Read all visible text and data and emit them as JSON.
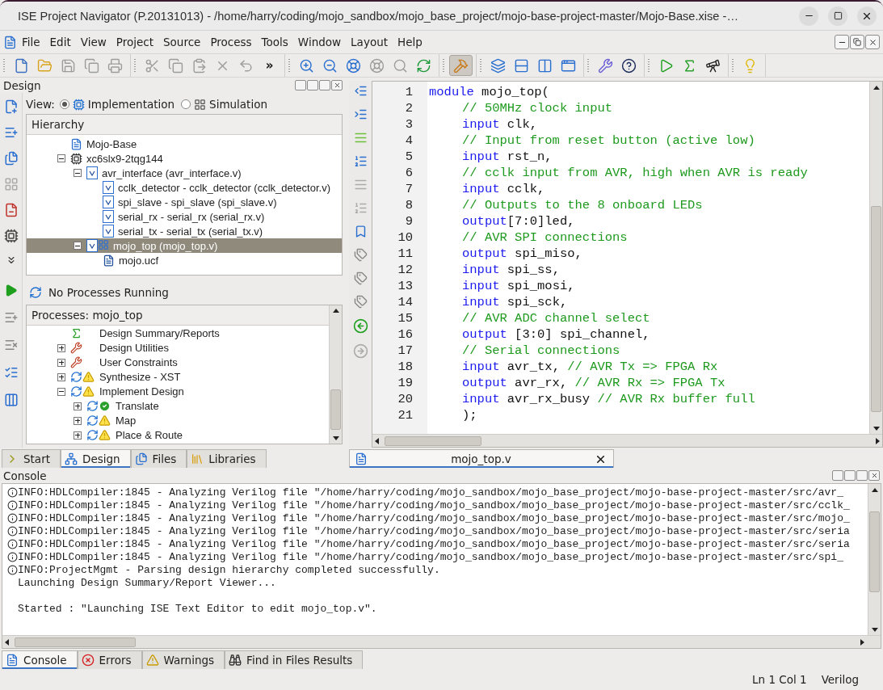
{
  "window": {
    "title": "ISE Project Navigator (P.20131013) - /home/harry/coding/mojo_sandbox/mojo_base_project/mojo-base-project-master/Mojo-Base.xise -…"
  },
  "menu": [
    "File",
    "Edit",
    "View",
    "Project",
    "Source",
    "Process",
    "Tools",
    "Window",
    "Layout",
    "Help"
  ],
  "toolbar_groups": [
    {
      "items": [
        {
          "kind": "new",
          "disabled": false,
          "selected": false
        },
        {
          "kind": "open",
          "disabled": false,
          "selected": false
        },
        {
          "kind": "save",
          "disabled": true,
          "selected": false
        },
        {
          "kind": "save-all",
          "disabled": true,
          "selected": false
        },
        {
          "kind": "print",
          "disabled": true,
          "selected": false
        }
      ]
    },
    {
      "items": [
        {
          "kind": "cut",
          "disabled": true,
          "selected": false
        },
        {
          "kind": "copy",
          "disabled": true,
          "selected": false
        },
        {
          "kind": "paste",
          "disabled": true,
          "selected": false
        },
        {
          "kind": "delete",
          "disabled": true,
          "selected": false
        },
        {
          "kind": "undo",
          "disabled": true,
          "selected": false
        },
        {
          "kind": "more",
          "text": "»",
          "disabled": false,
          "selected": false
        }
      ]
    },
    {
      "items": [
        {
          "kind": "zoom-in",
          "disabled": false,
          "selected": false
        },
        {
          "kind": "zoom-out",
          "disabled": false,
          "selected": false
        },
        {
          "kind": "zoom-full",
          "disabled": false,
          "selected": false
        },
        {
          "kind": "zoom-select",
          "disabled": true,
          "selected": false
        },
        {
          "kind": "find",
          "disabled": true,
          "selected": false
        },
        {
          "kind": "refresh",
          "disabled": false,
          "selected": false
        }
      ]
    },
    {
      "items": [
        {
          "kind": "hammer",
          "disabled": false,
          "selected": true
        }
      ]
    },
    {
      "items": [
        {
          "kind": "cascade",
          "disabled": false,
          "selected": false
        },
        {
          "kind": "tile-h",
          "disabled": false,
          "selected": false
        },
        {
          "kind": "tile-v",
          "disabled": false,
          "selected": false
        },
        {
          "kind": "windows",
          "disabled": false,
          "selected": false
        }
      ]
    },
    {
      "items": [
        {
          "kind": "wrench",
          "disabled": false,
          "selected": false
        },
        {
          "kind": "help",
          "disabled": false,
          "selected": false
        }
      ]
    },
    {
      "items": [
        {
          "kind": "run",
          "disabled": false,
          "selected": false
        },
        {
          "kind": "sigma",
          "disabled": false,
          "selected": false
        },
        {
          "kind": "telescope",
          "disabled": false,
          "selected": false
        }
      ]
    },
    {
      "items": [
        {
          "kind": "bulb",
          "disabled": false,
          "selected": false
        }
      ]
    }
  ],
  "design_panel": {
    "title": "Design",
    "view_label": "View:",
    "views": [
      {
        "label": "Implementation",
        "selected": true
      },
      {
        "label": "Simulation",
        "selected": false
      }
    ],
    "hierarchy_title": "Hierarchy",
    "tree": [
      {
        "label": "Mojo-Base",
        "kind": "project",
        "selected": false
      },
      {
        "label": "xc6slx9-2tqg144",
        "kind": "chip",
        "selected": false,
        "expanded": true,
        "children": [
          {
            "label": "avr_interface (avr_interface.v)",
            "kind": "verilog",
            "selected": false,
            "expanded": true,
            "children": [
              {
                "label": "cclk_detector - cclk_detector (cclk_detector.v)",
                "kind": "verilog",
                "selected": false
              },
              {
                "label": "spi_slave - spi_slave (spi_slave.v)",
                "kind": "verilog",
                "selected": false
              },
              {
                "label": "serial_rx - serial_rx (serial_rx.v)",
                "kind": "verilog",
                "selected": false
              },
              {
                "label": "serial_tx - serial_tx (serial_tx.v)",
                "kind": "verilog",
                "selected": false
              }
            ]
          },
          {
            "label": "mojo_top (mojo_top.v)",
            "kind": "verilog-top",
            "selected": true,
            "expanded": true,
            "children": [
              {
                "label": "mojo.ucf",
                "kind": "ucf",
                "selected": false
              }
            ]
          }
        ]
      }
    ]
  },
  "processes": {
    "status": "No Processes Running",
    "title": "Processes: mojo_top",
    "items": [
      {
        "label": "Design Summary/Reports",
        "kind": "summary",
        "warning": false,
        "passed": false
      },
      {
        "label": "Design Utilities",
        "kind": "tools",
        "warning": false,
        "passed": false,
        "expanded": false
      },
      {
        "label": "User Constraints",
        "kind": "tools",
        "warning": false,
        "passed": false,
        "expanded": false
      },
      {
        "label": "Synthesize - XST",
        "kind": "process",
        "warning": true,
        "passed": false,
        "expanded": false
      },
      {
        "label": "Implement Design",
        "kind": "process",
        "warning": true,
        "passed": false,
        "expanded": true,
        "children": [
          {
            "label": "Translate",
            "kind": "process",
            "warning": false,
            "passed": true,
            "expanded": false
          },
          {
            "label": "Map",
            "kind": "process",
            "warning": true,
            "passed": false,
            "expanded": false
          },
          {
            "label": "Place & Route",
            "kind": "process",
            "warning": true,
            "passed": false,
            "expanded": false
          }
        ]
      }
    ]
  },
  "left_tabs": [
    {
      "label": "Start",
      "kind": "start",
      "selected": false
    },
    {
      "label": "Design",
      "kind": "design",
      "selected": true
    },
    {
      "label": "Files",
      "kind": "files",
      "selected": false
    },
    {
      "label": "Libraries",
      "kind": "libraries",
      "selected": false
    }
  ],
  "editor": {
    "tab": {
      "label": "mojo_top.v",
      "selected": true
    },
    "lines": [
      {
        "number": "1",
        "indented": false,
        "tokens": [
          {
            "kind": "keyword",
            "text": "module"
          },
          {
            "kind": "text",
            "text": " mojo_top("
          }
        ]
      },
      {
        "number": "2",
        "indented": true,
        "tokens": [
          {
            "kind": "comment",
            "text": "// 50MHz clock input"
          }
        ]
      },
      {
        "number": "3",
        "indented": true,
        "tokens": [
          {
            "kind": "keyword",
            "text": "input"
          },
          {
            "kind": "text",
            "text": " clk,"
          }
        ]
      },
      {
        "number": "4",
        "indented": true,
        "tokens": [
          {
            "kind": "comment",
            "text": "// Input from reset button (active low)"
          }
        ]
      },
      {
        "number": "5",
        "indented": true,
        "tokens": [
          {
            "kind": "keyword",
            "text": "input"
          },
          {
            "kind": "text",
            "text": " rst_n,"
          }
        ]
      },
      {
        "number": "6",
        "indented": true,
        "tokens": [
          {
            "kind": "comment",
            "text": "// cclk input from AVR, high when AVR is ready"
          }
        ]
      },
      {
        "number": "7",
        "indented": true,
        "tokens": [
          {
            "kind": "keyword",
            "text": "input"
          },
          {
            "kind": "text",
            "text": " cclk,"
          }
        ]
      },
      {
        "number": "8",
        "indented": true,
        "tokens": [
          {
            "kind": "comment",
            "text": "// Outputs to the 8 onboard LEDs"
          }
        ]
      },
      {
        "number": "9",
        "indented": true,
        "tokens": [
          {
            "kind": "keyword",
            "text": "output"
          },
          {
            "kind": "text",
            "text": "[7:0]led,"
          }
        ]
      },
      {
        "number": "10",
        "indented": true,
        "tokens": [
          {
            "kind": "comment",
            "text": "// AVR SPI connections"
          }
        ]
      },
      {
        "number": "11",
        "indented": true,
        "tokens": [
          {
            "kind": "keyword",
            "text": "output"
          },
          {
            "kind": "text",
            "text": " spi_miso,"
          }
        ]
      },
      {
        "number": "12",
        "indented": true,
        "tokens": [
          {
            "kind": "keyword",
            "text": "input"
          },
          {
            "kind": "text",
            "text": " spi_ss,"
          }
        ]
      },
      {
        "number": "13",
        "indented": true,
        "tokens": [
          {
            "kind": "keyword",
            "text": "input"
          },
          {
            "kind": "text",
            "text": " spi_mosi,"
          }
        ]
      },
      {
        "number": "14",
        "indented": true,
        "tokens": [
          {
            "kind": "keyword",
            "text": "input"
          },
          {
            "kind": "text",
            "text": " spi_sck,"
          }
        ]
      },
      {
        "number": "15",
        "indented": true,
        "tokens": [
          {
            "kind": "comment",
            "text": "// AVR ADC channel select"
          }
        ]
      },
      {
        "number": "16",
        "indented": true,
        "tokens": [
          {
            "kind": "keyword",
            "text": "output"
          },
          {
            "kind": "text",
            "text": " [3:0] spi_channel,"
          }
        ]
      },
      {
        "number": "17",
        "indented": true,
        "tokens": [
          {
            "kind": "comment",
            "text": "// Serial connections"
          }
        ]
      },
      {
        "number": "18",
        "indented": true,
        "tokens": [
          {
            "kind": "keyword",
            "text": "input"
          },
          {
            "kind": "text",
            "text": " avr_tx, "
          },
          {
            "kind": "comment",
            "text": "// AVR Tx => FPGA Rx"
          }
        ]
      },
      {
        "number": "19",
        "indented": true,
        "tokens": [
          {
            "kind": "keyword",
            "text": "output"
          },
          {
            "kind": "text",
            "text": " avr_rx, "
          },
          {
            "kind": "comment",
            "text": "// AVR Rx => FPGA Tx"
          }
        ]
      },
      {
        "number": "20",
        "indented": true,
        "tokens": [
          {
            "kind": "keyword",
            "text": "input"
          },
          {
            "kind": "text",
            "text": " avr_rx_busy "
          },
          {
            "kind": "comment",
            "text": "// AVR Rx buffer full"
          }
        ]
      },
      {
        "number": "21",
        "indented": true,
        "tokens": [
          {
            "kind": "text",
            "text": ");"
          }
        ]
      }
    ]
  },
  "console": {
    "title": "Console",
    "lines": [
      {
        "text": "INFO:HDLCompiler:1845 - Analyzing Verilog file \"/home/harry/coding/mojo_sandbox/mojo_base_project/mojo-base-project-master/src/avr_",
        "info": true,
        "blank_before": false
      },
      {
        "text": "INFO:HDLCompiler:1845 - Analyzing Verilog file \"/home/harry/coding/mojo_sandbox/mojo_base_project/mojo-base-project-master/src/cclk_",
        "info": true,
        "blank_before": false
      },
      {
        "text": "INFO:HDLCompiler:1845 - Analyzing Verilog file \"/home/harry/coding/mojo_sandbox/mojo_base_project/mojo-base-project-master/src/mojo_",
        "info": true,
        "blank_before": false
      },
      {
        "text": "INFO:HDLCompiler:1845 - Analyzing Verilog file \"/home/harry/coding/mojo_sandbox/mojo_base_project/mojo-base-project-master/src/seria",
        "info": true,
        "blank_before": false
      },
      {
        "text": "INFO:HDLCompiler:1845 - Analyzing Verilog file \"/home/harry/coding/mojo_sandbox/mojo_base_project/mojo-base-project-master/src/seria",
        "info": true,
        "blank_before": false
      },
      {
        "text": "INFO:HDLCompiler:1845 - Analyzing Verilog file \"/home/harry/coding/mojo_sandbox/mojo_base_project/mojo-base-project-master/src/spi_",
        "info": true,
        "blank_before": false
      },
      {
        "text": "INFO:ProjectMgmt - Parsing design hierarchy completed successfully.",
        "info": true,
        "blank_before": false
      },
      {
        "text": "Launching Design Summary/Report Viewer...",
        "info": false,
        "blank_before": false
      },
      {
        "text": "Started : \"Launching ISE Text Editor to edit mojo_top.v\".",
        "info": false,
        "blank_before": true
      }
    ],
    "tabs": [
      {
        "label": "Console",
        "kind": "console",
        "selected": true
      },
      {
        "label": "Errors",
        "kind": "errors",
        "selected": false
      },
      {
        "label": "Warnings",
        "kind": "warnings",
        "selected": false
      },
      {
        "label": "Find in Files Results",
        "kind": "find",
        "selected": false
      }
    ]
  },
  "status_bar": {
    "position": "Ln 1 Col 1",
    "language": "Verilog"
  }
}
